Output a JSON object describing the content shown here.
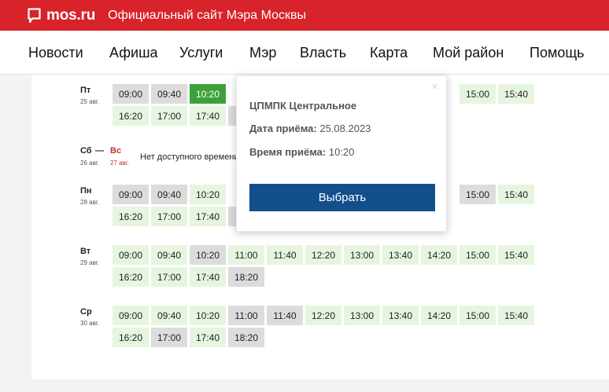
{
  "header": {
    "logo_text": "mos.ru",
    "site_title": "Официальный сайт Мэра Москвы",
    "brand_color": "#d8232a"
  },
  "nav": {
    "items": [
      "Новости",
      "Афиша",
      "Услуги",
      "Мэр",
      "Власть",
      "Карта",
      "Мой район",
      "Помощь"
    ]
  },
  "schedule": {
    "days": [
      {
        "weekday": "Пт",
        "date": "25 авг.",
        "rows": [
          [
            {
              "t": "09:00",
              "s": "busy"
            },
            {
              "t": "09:40",
              "s": "busy"
            },
            {
              "t": "10:20",
              "s": "selected"
            },
            {
              "t": "",
              "s": "hidden"
            },
            {
              "t": "",
              "s": "hidden"
            },
            {
              "t": "",
              "s": "hidden"
            },
            {
              "t": "",
              "s": "hidden"
            },
            {
              "t": "",
              "s": "hidden"
            },
            {
              "t": "",
              "s": "hidden"
            },
            {
              "t": "15:00",
              "s": "avail"
            },
            {
              "t": "15:40",
              "s": "avail"
            }
          ],
          [
            {
              "t": "16:20",
              "s": "avail"
            },
            {
              "t": "17:00",
              "s": "avail"
            },
            {
              "t": "17:40",
              "s": "avail"
            },
            {
              "t": "",
              "s": "busy"
            }
          ]
        ]
      },
      {
        "weekday": "Пн",
        "date": "28 авг.",
        "rows": [
          [
            {
              "t": "09:00",
              "s": "busy"
            },
            {
              "t": "09:40",
              "s": "busy"
            },
            {
              "t": "10:20",
              "s": "avail"
            },
            {
              "t": "",
              "s": "hidden"
            },
            {
              "t": "",
              "s": "hidden"
            },
            {
              "t": "",
              "s": "hidden"
            },
            {
              "t": "",
              "s": "hidden"
            },
            {
              "t": "",
              "s": "hidden"
            },
            {
              "t": "",
              "s": "hidden"
            },
            {
              "t": "15:00",
              "s": "busy"
            },
            {
              "t": "15:40",
              "s": "avail"
            }
          ],
          [
            {
              "t": "16:20",
              "s": "avail"
            },
            {
              "t": "17:00",
              "s": "avail"
            },
            {
              "t": "17:40",
              "s": "avail"
            },
            {
              "t": "",
              "s": "busy"
            }
          ]
        ]
      },
      {
        "weekday": "Вт",
        "date": "29 авг.",
        "rows": [
          [
            {
              "t": "09:00",
              "s": "avail"
            },
            {
              "t": "09:40",
              "s": "avail"
            },
            {
              "t": "10:20",
              "s": "busy"
            },
            {
              "t": "11:00",
              "s": "avail"
            },
            {
              "t": "11:40",
              "s": "avail"
            },
            {
              "t": "12:20",
              "s": "avail"
            },
            {
              "t": "13:00",
              "s": "avail"
            },
            {
              "t": "13:40",
              "s": "avail"
            },
            {
              "t": "14:20",
              "s": "avail"
            },
            {
              "t": "15:00",
              "s": "avail"
            },
            {
              "t": "15:40",
              "s": "avail"
            }
          ],
          [
            {
              "t": "16:20",
              "s": "avail"
            },
            {
              "t": "17:00",
              "s": "avail"
            },
            {
              "t": "17:40",
              "s": "avail"
            },
            {
              "t": "18:20",
              "s": "busy"
            }
          ]
        ]
      },
      {
        "weekday": "Ср",
        "date": "30 авг.",
        "rows": [
          [
            {
              "t": "09:00",
              "s": "avail"
            },
            {
              "t": "09:40",
              "s": "avail"
            },
            {
              "t": "10:20",
              "s": "avail"
            },
            {
              "t": "11:00",
              "s": "busy"
            },
            {
              "t": "11:40",
              "s": "busy"
            },
            {
              "t": "12:20",
              "s": "avail"
            },
            {
              "t": "13:00",
              "s": "avail"
            },
            {
              "t": "13:40",
              "s": "avail"
            },
            {
              "t": "14:20",
              "s": "avail"
            },
            {
              "t": "15:00",
              "s": "avail"
            },
            {
              "t": "15:40",
              "s": "avail"
            }
          ],
          [
            {
              "t": "16:20",
              "s": "avail"
            },
            {
              "t": "17:00",
              "s": "busy"
            },
            {
              "t": "17:40",
              "s": "avail"
            },
            {
              "t": "18:20",
              "s": "busy"
            }
          ]
        ]
      }
    ],
    "weekend": {
      "sat": "Сб",
      "sat_date": "26 авг.",
      "dash": "—",
      "sun": "Вс",
      "sun_date": "27 авг.",
      "message": "Нет доступного времени"
    },
    "colors": {
      "available": "#e6f5df",
      "busy": "#dcdcdc",
      "selected": "#3ba23a"
    }
  },
  "popup": {
    "org": "ЦПМПК Центральное",
    "date_label": "Дата приёма:",
    "date_value": "25.08.2023",
    "time_label": "Время приёма:",
    "time_value": "10:20",
    "button_label": "Выбрать",
    "close_symbol": "×",
    "button_color": "#134f8a"
  }
}
